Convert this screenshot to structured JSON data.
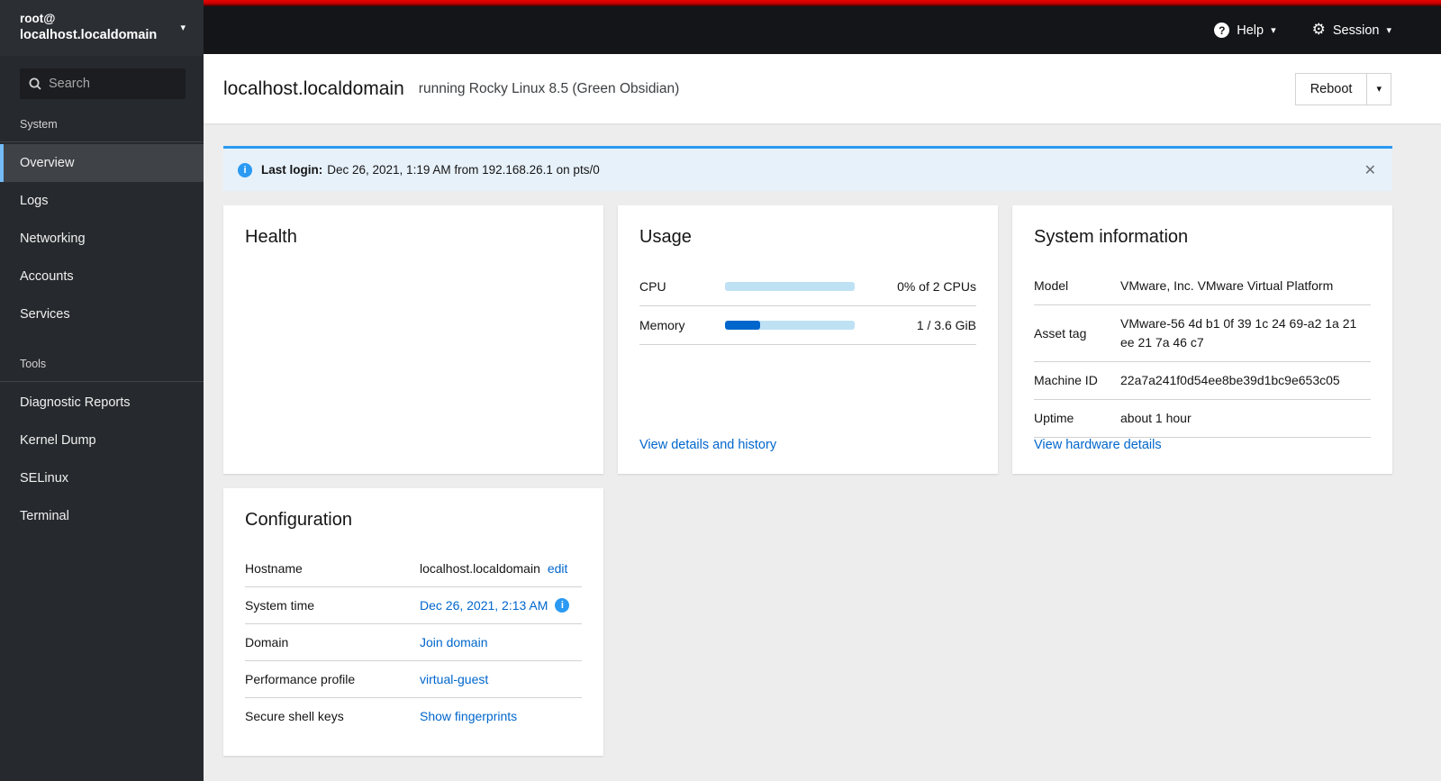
{
  "masthead": {
    "user": {
      "line1": "root@",
      "line2": "localhost.localdomain"
    },
    "help_label": "Help",
    "session_label": "Session"
  },
  "sidebar": {
    "search_placeholder": "Search",
    "sections": [
      {
        "label": "System",
        "items": [
          {
            "label": "Overview",
            "selected": true
          },
          {
            "label": "Logs",
            "selected": false
          },
          {
            "label": "Networking",
            "selected": false
          },
          {
            "label": "Accounts",
            "selected": false
          },
          {
            "label": "Services",
            "selected": false
          }
        ]
      },
      {
        "label": "Tools",
        "items": [
          {
            "label": "Diagnostic Reports",
            "selected": false
          },
          {
            "label": "Kernel Dump",
            "selected": false
          },
          {
            "label": "SELinux",
            "selected": false
          },
          {
            "label": "Terminal",
            "selected": false
          }
        ]
      }
    ]
  },
  "page_header": {
    "hostname": "localhost.localdomain",
    "os_text": "running Rocky Linux 8.5 (Green Obsidian)",
    "reboot_label": "Reboot"
  },
  "alert": {
    "bold_label": "Last login:",
    "message": "Dec 26, 2021, 1:19 AM from 192.168.26.1 on pts/0"
  },
  "health_card": {
    "title": "Health"
  },
  "usage_card": {
    "title": "Usage",
    "rows": [
      {
        "label": "CPU",
        "value": "0% of 2 CPUs",
        "percent": 0
      },
      {
        "label": "Memory",
        "value": "1 / 3.6 GiB",
        "percent": 27
      }
    ],
    "link": "View details and history"
  },
  "system_info_card": {
    "title": "System information",
    "rows": [
      {
        "label": "Model",
        "value": "VMware, Inc. VMware Virtual Platform"
      },
      {
        "label": "Asset tag",
        "value": "VMware-56 4d b1 0f 39 1c 24 69-a2 1a 21 ee 21 7a 46 c7"
      },
      {
        "label": "Machine ID",
        "value": "22a7a241f0d54ee8be39d1bc9e653c05"
      },
      {
        "label": "Uptime",
        "value": "about 1 hour"
      }
    ],
    "link": "View hardware details"
  },
  "configuration_card": {
    "title": "Configuration",
    "rows": [
      {
        "label": "Hostname",
        "value": "localhost.localdomain",
        "link": "edit",
        "info_icon": false
      },
      {
        "label": "System time",
        "value": "",
        "link": "Dec 26, 2021, 2:13 AM",
        "info_icon": true
      },
      {
        "label": "Domain",
        "value": "",
        "link": "Join domain",
        "info_icon": false
      },
      {
        "label": "Performance profile",
        "value": "",
        "link": "virtual-guest",
        "info_icon": false
      },
      {
        "label": "Secure shell keys",
        "value": "",
        "link": "Show fingerprints",
        "info_icon": false
      }
    ]
  },
  "icons": {
    "search": "search-icon",
    "help": "question-circle-icon",
    "session": "gear-icon",
    "info": "info-circle-icon",
    "close": "close-icon",
    "caret": "chevron-down-icon"
  },
  "colors": {
    "accent_red": "#cc0000",
    "link_blue": "#0066cc",
    "alert_border_blue": "#2b9af3",
    "alert_bg": "#e7f1fa",
    "progress_track": "#bee1f4",
    "progress_fill": "#0066cc",
    "selected_nav_border": "#73bcf7",
    "sidebar_bg": "#26292d",
    "masthead_bg": "#141519",
    "content_bg": "#ededed"
  }
}
